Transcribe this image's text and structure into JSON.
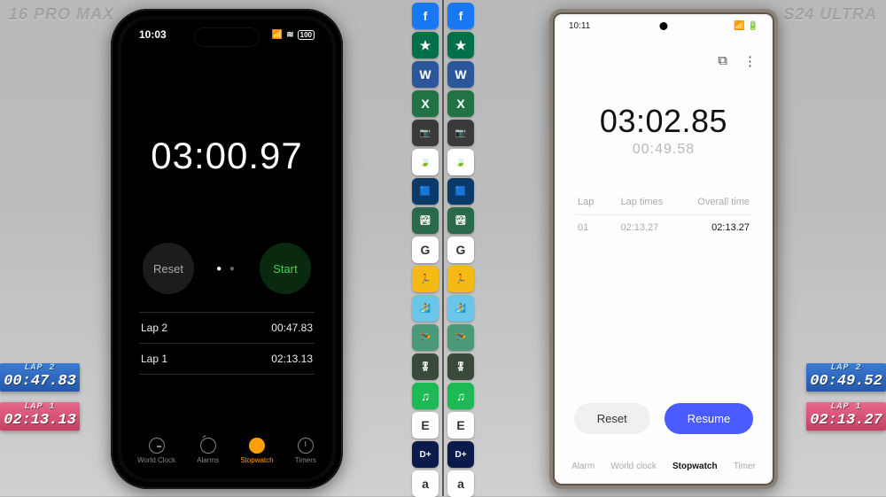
{
  "titles": {
    "left": "16 PRO MAX",
    "right": "S24 ULTRA"
  },
  "icons": [
    {
      "name": "facebook-icon",
      "bg": "#1877f2",
      "glyph": "f"
    },
    {
      "name": "starbucks-icon",
      "bg": "#00704a",
      "glyph": "★"
    },
    {
      "name": "word-icon",
      "bg": "#2b579a",
      "glyph": "W"
    },
    {
      "name": "excel-icon",
      "bg": "#217346",
      "glyph": "X"
    },
    {
      "name": "camera-icon",
      "bg": "#3a3a3a",
      "glyph": "📷"
    },
    {
      "name": "snapseed-icon",
      "bg": "#ffffff",
      "glyph": "🍃"
    },
    {
      "name": "app-blue-icon",
      "bg": "#0a3a6a",
      "glyph": "🟦"
    },
    {
      "name": "landscape-icon",
      "bg": "#2a6a4a",
      "glyph": "🏞"
    },
    {
      "name": "google-icon",
      "bg": "#ffffff",
      "glyph": "G"
    },
    {
      "name": "subway-surfers-icon",
      "bg": "#f5b915",
      "glyph": "🏃"
    },
    {
      "name": "game2-icon",
      "bg": "#6ac6e8",
      "glyph": "🏄"
    },
    {
      "name": "game3-icon",
      "bg": "#4a9a7a",
      "glyph": "🪂"
    },
    {
      "name": "cod-icon",
      "bg": "#3a4a3a",
      "glyph": "🎖"
    },
    {
      "name": "spotify-icon",
      "bg": "#1db954",
      "glyph": "♫"
    },
    {
      "name": "espn-icon",
      "bg": "#ffffff",
      "glyph": "E"
    },
    {
      "name": "disney-plus-icon",
      "bg": "#0a1a4a",
      "glyph": "D+"
    },
    {
      "name": "amazon-icon",
      "bg": "#ffffff",
      "glyph": "a"
    }
  ],
  "iphone": {
    "status_time": "10:03",
    "signal": "●●●●",
    "wifi": "≋",
    "battery": "100",
    "stopwatch_time": "03:00.97",
    "reset_label": "Reset",
    "start_label": "Start",
    "laps": [
      {
        "label": "Lap 2",
        "time": "00:47.83"
      },
      {
        "label": "Lap 1",
        "time": "02:13.13"
      }
    ],
    "tabs": [
      {
        "label": "World Clock",
        "active": false
      },
      {
        "label": "Alarms",
        "active": false
      },
      {
        "label": "Stopwatch",
        "active": true
      },
      {
        "label": "Timers",
        "active": false
      }
    ]
  },
  "samsung": {
    "status_time": "10:11",
    "stopwatch_time": "03:02.85",
    "sub_time": "00:49.58",
    "headers": {
      "lap": "Lap",
      "laptimes": "Lap times",
      "overall": "Overall time"
    },
    "rows": [
      {
        "lap": "01",
        "laptime": "02:13.27",
        "overall": "02:13.27"
      }
    ],
    "reset_label": "Reset",
    "resume_label": "Resume",
    "tabs": [
      {
        "label": "Alarm",
        "active": false
      },
      {
        "label": "World clock",
        "active": false
      },
      {
        "label": "Stopwatch",
        "active": true
      },
      {
        "label": "Timer",
        "active": false
      }
    ]
  },
  "overlay": {
    "left_lap2": {
      "label": "LAP 2",
      "value": "00:47.83"
    },
    "left_lap1": {
      "label": "LAP 1",
      "value": "02:13.13"
    },
    "right_lap2": {
      "label": "LAP 2",
      "value": "00:49.52"
    },
    "right_lap1": {
      "label": "LAP 1",
      "value": "02:13.27"
    }
  }
}
